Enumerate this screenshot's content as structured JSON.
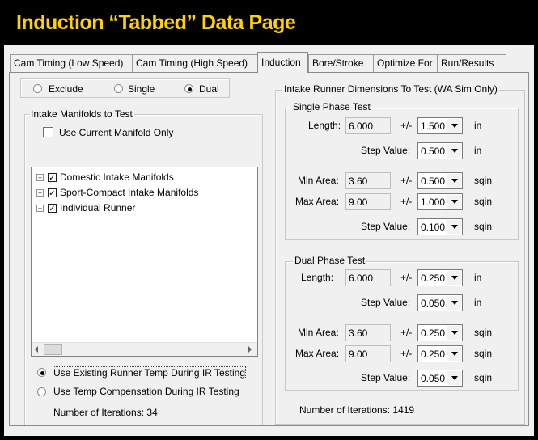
{
  "title": "Induction “Tabbed” Data Page",
  "tabs": [
    "Cam Timing (Low Speed)",
    "Cam Timing (High Speed)",
    "Induction",
    "Bore/Stroke",
    "Optimize For",
    "Run/Results"
  ],
  "active_tab": "Induction",
  "mode": {
    "options": [
      "Exclude",
      "Single",
      "Dual"
    ],
    "selected": "Dual"
  },
  "manifolds": {
    "label": "Intake Manifolds to Test",
    "use_current_label": "Use Current Manifold Only",
    "use_current_checked": false,
    "tree": [
      {
        "label": "Domestic Intake Manifolds",
        "checked": true
      },
      {
        "label": "Sport-Compact Intake Manifolds",
        "checked": true
      },
      {
        "label": "Individual Runner",
        "checked": true
      }
    ],
    "temp_options": [
      "Use Existing Runner Temp During IR Testing",
      "Use Temp Compensation During IR Testing"
    ],
    "temp_selected": "Use Existing Runner Temp During IR Testing",
    "iterations_label": "Number of Iterations:",
    "iterations": "34"
  },
  "runner": {
    "label": "Intake Runner Dimensions To Test (WA Sim Only)",
    "single": {
      "label": "Single Phase Test",
      "length_label": "Length:",
      "length": "6.000",
      "length_pm": "1.500",
      "length_unit": "in",
      "length_step_label": "Step Value:",
      "length_step": "0.500",
      "length_step_unit": "in",
      "min_area_label": "Min Area:",
      "min_area": "3.60",
      "min_area_pm": "0.500",
      "min_area_unit": "sqin",
      "max_area_label": "Max Area:",
      "max_area": "9.00",
      "max_area_pm": "1.000",
      "max_area_unit": "sqin",
      "area_step_label": "Step Value:",
      "area_step": "0.100",
      "area_step_unit": "sqin"
    },
    "dual": {
      "label": "Dual Phase Test",
      "length_label": "Length:",
      "length": "6.000",
      "length_pm": "0.250",
      "length_unit": "in",
      "length_step_label": "Step Value:",
      "length_step": "0.050",
      "length_step_unit": "in",
      "min_area_label": "Min Area:",
      "min_area": "3.60",
      "min_area_pm": "0.250",
      "min_area_unit": "sqin",
      "max_area_label": "Max Area:",
      "max_area": "9.00",
      "max_area_pm": "0.250",
      "max_area_unit": "sqin",
      "area_step_label": "Step Value:",
      "area_step": "0.050",
      "area_step_unit": "sqin"
    },
    "pm_symbol": "+/-",
    "iterations_label": "Number of Iterations:",
    "iterations": "1419"
  }
}
